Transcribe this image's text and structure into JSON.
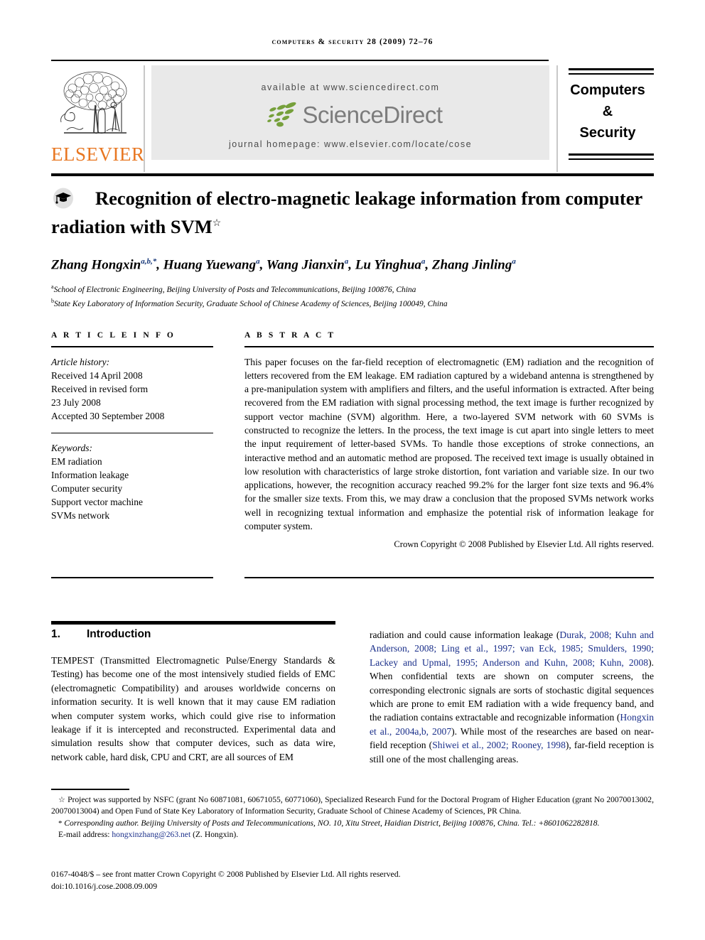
{
  "running_head": "computers & security 28 (2009) 72–76",
  "masthead": {
    "publisher": "ELSEVIER",
    "available_at": "available at www.sciencedirect.com",
    "sciencedirect_word": "ScienceDirect",
    "journal_homepage": "journal homepage: www.elsevier.com/locate/cose",
    "journal_box": {
      "line1": "Computers",
      "line2": "&",
      "line3": "Security"
    }
  },
  "article": {
    "title_line1": "Recognition of electro-magnetic leakage information",
    "title_line2": "from computer radiation with SVM",
    "title_star": "☆",
    "authors_html": "Zhang Hongxin<sup>a,b,</sup><sup>*</sup>, Huang Yuewang<sup>a</sup>, Wang Jianxin<sup>a</sup>, Lu Yinghua<sup>a</sup>, Zhang Jinling<sup>a</sup>",
    "affiliation_a": "School of Electronic Engineering, Beijing University of Posts and Telecommunications, Beijing 100876, China",
    "affiliation_b": "State Key Laboratory of Information Security, Graduate School of Chinese Academy of Sciences, Beijing 100049, China"
  },
  "info": {
    "heading": "A R T I C L E    I N F O",
    "history_label": "Article history:",
    "history": [
      "Received 14 April 2008",
      "Received in revised form",
      "23 July 2008",
      "Accepted 30 September 2008"
    ],
    "keywords_label": "Keywords:",
    "keywords": [
      "EM radiation",
      "Information leakage",
      "Computer security",
      "Support vector machine",
      "SVMs network"
    ]
  },
  "abstract": {
    "heading": "A B S T R A C T",
    "text": "This paper focuses on the far-field reception of electromagnetic (EM) radiation and the recognition of letters recovered from the EM leakage. EM radiation captured by a wideband antenna is strengthened by a pre-manipulation system with amplifiers and filters, and the useful information is extracted. After being recovered from the EM radiation with signal processing method, the text image is further recognized by support vector machine (SVM) algorithm. Here, a two-layered SVM network with 60 SVMs is constructed to recognize the letters. In the process, the text image is cut apart into single letters to meet the input requirement of letter-based SVMs. To handle those exceptions of stroke connections, an interactive method and an automatic method are proposed. The received text image is usually obtained in low resolution with characteristics of large stroke distortion, font variation and variable size. In our two applications, however, the recognition accuracy reached 99.2% for the larger font size texts and 96.4% for the smaller size texts. From this, we may draw a conclusion that the proposed SVMs network works well in recognizing textual information and emphasize the potential risk of information leakage for computer system.",
    "copyright": "Crown Copyright © 2008 Published by Elsevier Ltd. All rights reserved."
  },
  "section": {
    "number": "1.",
    "title": "Introduction"
  },
  "body": {
    "left_column": "TEMPEST (Transmitted Electromagnetic Pulse/Energy Standards & Testing) has become one of the most intensively studied fields of EMC (electromagnetic Compatibility) and arouses worldwide concerns on information security. It is well known that it may cause EM radiation when computer system works, which could give rise to information leakage if it is intercepted and reconstructed. Experimental data and simulation results show that computer devices, such as data wire, network cable, hard disk, CPU and CRT, are all sources of EM",
    "right_column_parts": [
      {
        "t": "radiation and could cause information leakage (",
        "c": false
      },
      {
        "t": "Durak, 2008; Kuhn and Anderson, 2008; Ling et al., 1997; van Eck, 1985; Smulders, 1990; Lackey and Upmal, 1995; Anderson and Kuhn, 2008; Kuhn, 2008",
        "c": true
      },
      {
        "t": "). When confidential texts are shown on computer screens, the corresponding electronic signals are sorts of stochastic digital sequences which are prone to emit EM radiation with a wide frequency band, and the radiation contains extractable and recognizable information (",
        "c": false
      },
      {
        "t": "Hongxin et al., 2004a,b, 2007",
        "c": true
      },
      {
        "t": "). While most of the researches are based on near-field reception (",
        "c": false
      },
      {
        "t": "Shiwei et al., 2002; Rooney, 1998",
        "c": true
      },
      {
        "t": "), far-field reception is still one of the most challenging areas.",
        "c": false
      }
    ]
  },
  "footnotes": {
    "grant": "Project was supported by NSFC (grant No  60871081, 60671055, 60771060), Specialized Research Fund for the Doctoral Program of Higher Education (grant No 20070013002, 20070013004) and Open Fund of State Key Laboratory of Information Security, Graduate School of Chinese Academy of Sciences, PR China.",
    "corresponding": "Corresponding author. Beijing University of Posts and Telecommunications, NO. 10, Xitu Street, Haidian District, Beijing 100876, China. Tel.: +8601062282818.",
    "email_label": "E-mail address:",
    "email": "hongxinzhang@263.net",
    "email_suffix": "(Z. Hongxin).",
    "issn_line": "0167-4048/$ – see front matter Crown Copyright © 2008 Published by Elsevier Ltd. All rights reserved.",
    "doi_line": "doi:10.1016/j.cose.2008.09.009"
  },
  "colors": {
    "elsevier_orange": "#E87722",
    "sciencedirect_green": "#76A03B",
    "sciencedirect_gray": "#7c7c7c",
    "citation_blue": "#1a2f8a",
    "panel_gray": "#e9e9e9"
  }
}
